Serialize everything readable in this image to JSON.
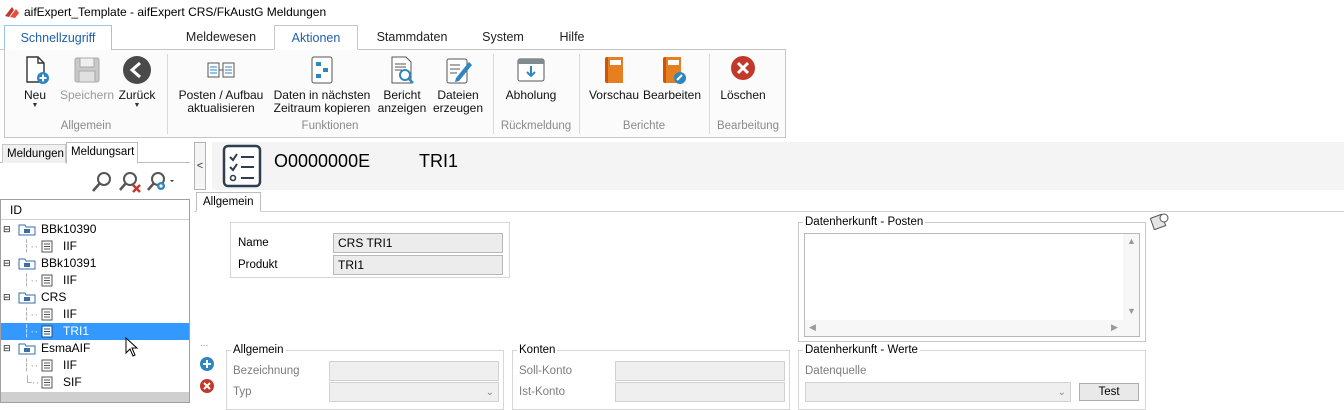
{
  "window": {
    "title": "aifExpert_Template - aifExpert CRS/FkAustG Meldungen"
  },
  "ribbon": {
    "quick_access_tab": "Schnellzugriff",
    "tabs": [
      {
        "label": "Meldewesen"
      },
      {
        "label": "Aktionen",
        "active": true
      },
      {
        "label": "Stammdaten"
      },
      {
        "label": "System"
      },
      {
        "label": "Hilfe"
      }
    ],
    "groups": {
      "allgemein": "Allgemein",
      "funktionen": "Funktionen",
      "rueckmeldung": "Rückmeldung",
      "berichte": "Berichte",
      "bearbeitung": "Bearbeitung"
    },
    "buttons": {
      "neu": "Neu",
      "speichern": "Speichern",
      "zurueck": "Zurück",
      "posten_1": "Posten / Aufbau",
      "posten_2": "aktualisieren",
      "daten_1": "Daten in nächsten",
      "daten_2": "Zeitraum kopieren",
      "bericht_1": "Bericht",
      "bericht_2": "anzeigen",
      "dateien_1": "Dateien",
      "dateien_2": "erzeugen",
      "abholung": "Abholung",
      "vorschau": "Vorschau",
      "bearbeiten": "Bearbeiten",
      "loeschen": "Löschen"
    }
  },
  "left_panel": {
    "tabs": [
      {
        "label": "Meldungen"
      },
      {
        "label": "Meldungsart",
        "active": true
      }
    ],
    "tree_header": "ID",
    "tree": {
      "bbk10390": "BBk10390",
      "bbk10390_iif": "IIF",
      "bbk10391": "BBk10391",
      "bbk10391_iif": "IIF",
      "crs": "CRS",
      "crs_iif": "IIF",
      "crs_tri1": "TRI1",
      "esmaaif": "EsmaAIF",
      "esmaaif_iif": "IIF",
      "esmaaif_sif": "SIF"
    }
  },
  "detail": {
    "collapse_glyph": "<",
    "code": "O0000000E",
    "name": "TRI1",
    "tab": "Allgemein",
    "name_label": "Name",
    "name_value": "CRS TRI1",
    "produkt_label": "Produkt",
    "produkt_value": "TRI1",
    "datenherkunft_posten": "Datenherkunft - Posten",
    "allgemein_group": "Allgemein",
    "bezeichnung_label": "Bezeichnung",
    "typ_label": "Typ",
    "konten_group": "Konten",
    "soll_konto_label": "Soll-Konto",
    "ist_konto_label": "Ist-Konto",
    "datenherkunft_werte": "Datenherkunft - Werte",
    "datenquelle_label": "Datenquelle",
    "test_button": "Test",
    "side_dots": "..."
  }
}
